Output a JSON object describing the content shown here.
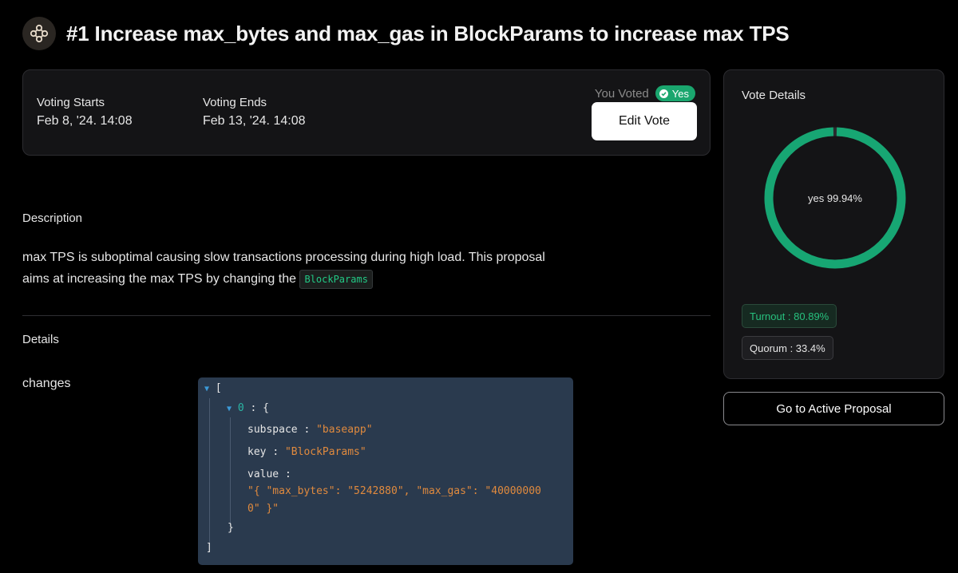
{
  "header": {
    "logo_icon": "dao-knot-icon",
    "title": "#1 Increase max_bytes and max_gas in BlockParams to increase max TPS"
  },
  "voting": {
    "starts_label": "Voting Starts",
    "starts_value": "Feb 8, '24. 14:08",
    "ends_label": "Voting Ends",
    "ends_value": "Feb 13, '24. 14:08",
    "you_voted_label": "You Voted",
    "vote_badge": "Yes",
    "vote_badge_icon": "check-circle-icon",
    "edit_button": "Edit Vote"
  },
  "description": {
    "label": "Description",
    "text_line1": "max TPS is suboptimal causing slow transactions processing during high load. This proposal",
    "text_line2": "aims at increasing the max TPS by changing the",
    "code_chip": "BlockParams"
  },
  "details": {
    "label": "Details",
    "changes_label": "changes",
    "json": {
      "open_bracket": "[",
      "close_bracket": "]",
      "index": "0",
      "colon": ":",
      "open_brace": "{",
      "close_brace": "}",
      "subspace_key": "subspace",
      "subspace_value": "\"baseapp\"",
      "key_key": "key",
      "key_value": "\"BlockParams\"",
      "value_key": "value",
      "value_line1": "\"{ \"max_bytes\": \"5242880\", \"max_gas\": \"40000000",
      "value_line2": "0\" }\""
    }
  },
  "vote_details": {
    "title": "Vote Details",
    "donut_label": "yes 99.94%",
    "yes_fraction": 0.9994,
    "yes_color": "#17a673",
    "turnout": "Turnout : 80.89%",
    "quorum": "Quorum : 33.4%"
  },
  "active_proposal_button": "Go to Active Proposal"
}
